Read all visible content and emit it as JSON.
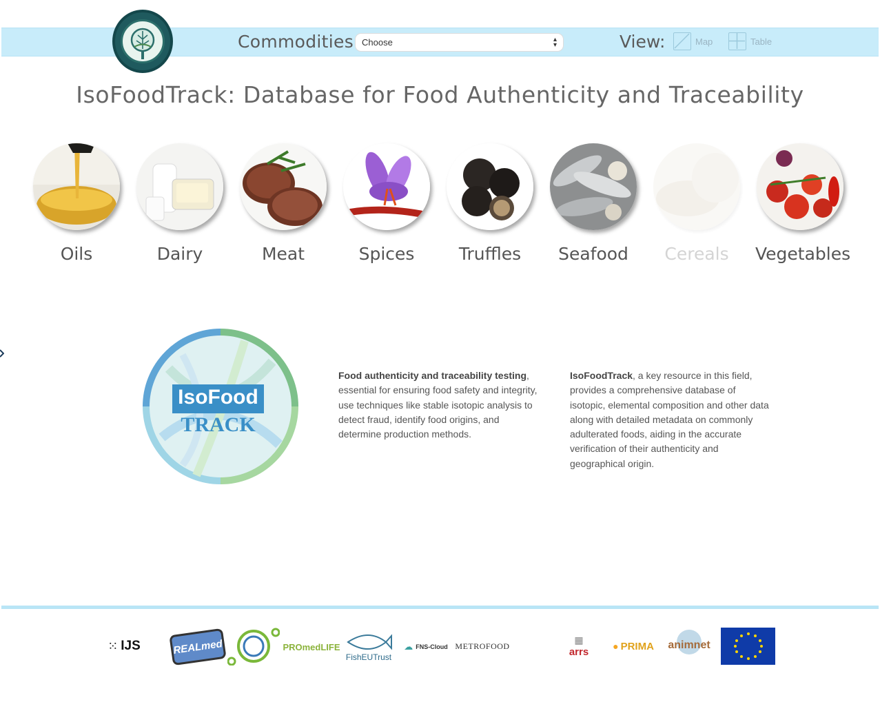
{
  "header": {
    "commodities_label": "Commodities:",
    "select_value": "Choose",
    "view_label": "View:",
    "map_label": "Map",
    "table_label": "Table"
  },
  "page_title": "IsoFoodTrack: Database for Food Authenticity and Traceability",
  "categories": [
    {
      "label": "Oils",
      "enabled": true
    },
    {
      "label": "Dairy",
      "enabled": true
    },
    {
      "label": "Meat",
      "enabled": true
    },
    {
      "label": "Spices",
      "enabled": true
    },
    {
      "label": "Truffles",
      "enabled": true
    },
    {
      "label": "Seafood",
      "enabled": true
    },
    {
      "label": "Cereals",
      "enabled": false
    },
    {
      "label": "Vegetables",
      "enabled": true
    }
  ],
  "logo": {
    "line1": "IsoFood",
    "line2": "TRACK"
  },
  "description1": {
    "bold": "Food authenticity and traceability testing",
    "text": ", essential for ensuring food safety and integrity, use techniques like stable isotopic analysis to detect fraud, identify food origins, and determine production methods."
  },
  "description2": {
    "bold": "IsoFoodTrack",
    "text": ", a key resource in this field, provides a comprehensive database of isotopic, elemental composition and other data along with detailed metadata on commonly adulterated foods, aiding in the accurate verification of their authenticity and geographical origin."
  },
  "partners": {
    "ijs": "IJS",
    "realmed": "REALmed",
    "promedlife": "PROmedLIFE",
    "fisheutrust": "FishEUTrust",
    "fnscloud": "FNS-Cloud",
    "metrofood": "METROFOOD",
    "arrs": "arrs",
    "prima": "PRIMA",
    "animnet": "animnet"
  },
  "colors": {
    "topbar": "#c8ecfa",
    "accent": "#3a8fc7",
    "text": "#555555"
  }
}
